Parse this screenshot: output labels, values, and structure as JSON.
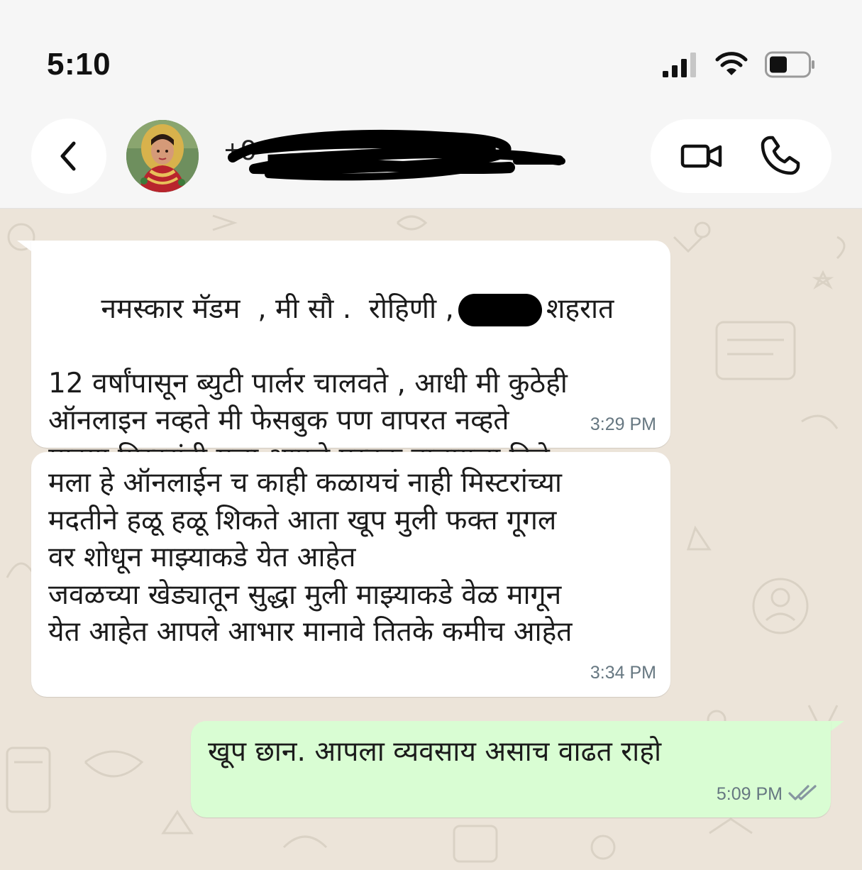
{
  "status_bar": {
    "time": "5:10"
  },
  "header": {
    "contact_name": "+9",
    "icons": {
      "back": "chevron-left-icon",
      "video": "video-camera-icon",
      "phone": "phone-icon"
    }
  },
  "messages": [
    {
      "direction": "incoming",
      "text_part1": "नमस्कार मॅडम  , मी सौ .  रोहिणी ,",
      "text_part2": "शहरात",
      "text_rest": "12 वर्षांपासून ब्युटी पार्लर चालवते , आधी मी कुठेही\nऑनलाइन नव्हते मी फेसबुक पण वापरत नव्हते\nमाझ्या मिस्टरांनी मला आपले पुस्तक वाचायला दिले",
      "time": "3:29 PM"
    },
    {
      "direction": "incoming",
      "text": "मला हे ऑनलाईन च काही कळायचं नाही मिस्टरांच्या\nमदतीने हळू हळू शिकते आता खूप मुली फक्त गूगल\nवर शोधून माझ्याकडे येत आहेत\nजवळच्या खेड्यातून सुद्धा मुली माझ्याकडे वेळ मागून\nयेत आहेत आपले आभार मानावे तितके कमीच आहेत",
      "time": "3:34 PM"
    },
    {
      "direction": "outgoing",
      "text": "खूप छान. आपला व्यवसाय असाच वाढत राहो",
      "time": "5:09 PM",
      "status": "read"
    }
  ],
  "colors": {
    "incoming_bubble": "#ffffff",
    "outgoing_bubble": "#d9fdd3",
    "wallpaper": "#ece4d9",
    "timestamp": "#667781"
  }
}
